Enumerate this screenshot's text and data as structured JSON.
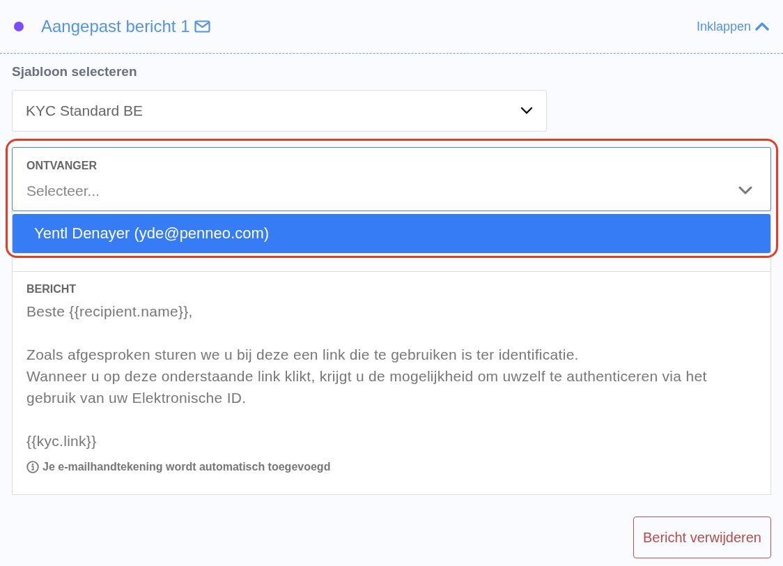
{
  "header": {
    "title": "Aangepast bericht 1",
    "collapse_label": "Inklappen"
  },
  "template": {
    "label": "Sjabloon selecteren",
    "value": "KYC Standard BE"
  },
  "recipient": {
    "label": "ONTVANGER",
    "placeholder": "Selecteer...",
    "expanded": true,
    "options": [
      {
        "label": "Yentl Denayer (yde@penneo.com)",
        "selected": true
      }
    ]
  },
  "message": {
    "label": "BERICHT",
    "body": "Beste {{recipient.name}},\n\nZoals afgesproken sturen we u bij deze een link die te gebruiken is ter identificatie.\nWanneer u op deze onderstaande link klikt, krijgt u de mogelijkheid om uwzelf te authenticeren via het gebruik van uw Elektronische ID.\n\n{{kyc.link}}",
    "note": "Je e-mailhandtekening wordt automatisch toegevoegd"
  },
  "highlight": true,
  "delete_button": "Bericht verwijderen"
}
